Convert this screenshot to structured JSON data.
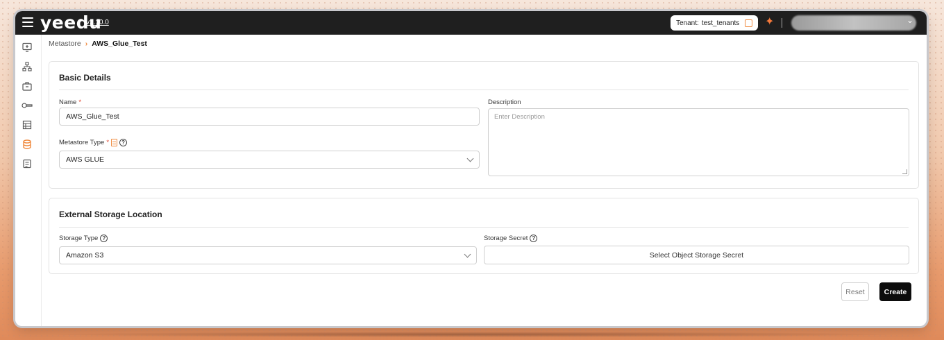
{
  "app": {
    "logo": "yeedu",
    "version": "v2.10.0"
  },
  "topbar": {
    "tenant_label": "Tenant:",
    "tenant_value": "test_tenants"
  },
  "sidebar": {
    "items": [
      {
        "icon": "monitor-plus-icon"
      },
      {
        "icon": "cluster-hierarchy-icon"
      },
      {
        "icon": "briefcase-icon"
      },
      {
        "icon": "key-icon"
      },
      {
        "icon": "table-grid-icon"
      },
      {
        "icon": "database-icon",
        "active": true
      },
      {
        "icon": "notes-icon"
      }
    ],
    "active_color": "#f08a3e"
  },
  "breadcrumb": {
    "parent": "Metastore",
    "current": "AWS_Glue_Test"
  },
  "basic_details": {
    "title": "Basic Details",
    "name_label": "Name",
    "name_value": "AWS_Glue_Test",
    "type_label": "Metastore Type",
    "type_value": "AWS GLUE",
    "description_label": "Description",
    "description_placeholder": "Enter Description"
  },
  "storage": {
    "title": "External Storage Location",
    "type_label": "Storage Type",
    "type_value": "Amazon S3",
    "secret_label": "Storage Secret",
    "secret_button": "Select Object Storage Secret"
  },
  "actions": {
    "reset": "Reset",
    "create": "Create"
  },
  "required_marker": "*",
  "help_glyph": "?"
}
